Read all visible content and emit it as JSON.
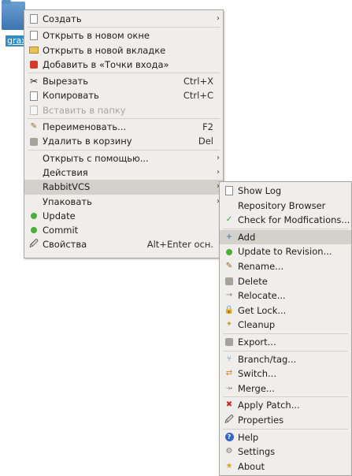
{
  "desktop": {
    "icon_label": "grax"
  },
  "main_menu": {
    "items": [
      {
        "label": "Создать",
        "shortcut": "",
        "submenu": true,
        "icon": "new-icon"
      },
      {
        "sep": true
      },
      {
        "label": "Открыть в новом окне",
        "shortcut": "",
        "icon": "new-window-icon"
      },
      {
        "label": "Открыть в новой вкладке",
        "shortcut": "",
        "icon": "new-tab-icon"
      },
      {
        "label": "Добавить в «Точки входа»",
        "shortcut": "",
        "icon": "bookmark-icon"
      },
      {
        "sep": true
      },
      {
        "label": "Вырезать",
        "shortcut": "Ctrl+X",
        "icon": "cut-icon"
      },
      {
        "label": "Копировать",
        "shortcut": "Ctrl+C",
        "icon": "copy-icon"
      },
      {
        "label": "Вставить в папку",
        "shortcut": "",
        "icon": "paste-icon",
        "disabled": true
      },
      {
        "sep": true
      },
      {
        "label": "Переименовать...",
        "shortcut": "F2",
        "icon": "rename-icon"
      },
      {
        "label": "Удалить в корзину",
        "shortcut": "Del",
        "icon": "trash-icon"
      },
      {
        "sep": true
      },
      {
        "label": "Открыть с помощью...",
        "shortcut": "",
        "submenu": true,
        "icon": ""
      },
      {
        "label": "Действия",
        "shortcut": "",
        "submenu": true,
        "icon": ""
      },
      {
        "label": "RabbitVCS",
        "shortcut": "",
        "submenu": true,
        "icon": "",
        "highlighted": true
      },
      {
        "label": "Упаковать",
        "shortcut": "",
        "submenu": true,
        "icon": ""
      },
      {
        "label": "Update",
        "shortcut": "",
        "icon": "update-icon"
      },
      {
        "label": "Commit",
        "shortcut": "",
        "icon": "commit-icon"
      },
      {
        "label": "Свойства",
        "shortcut": "Alt+Enter осн.",
        "icon": "properties-icon"
      }
    ]
  },
  "sub_menu": {
    "items": [
      {
        "label": "Show Log",
        "icon": "log-icon"
      },
      {
        "label": "Repository Browser",
        "icon": ""
      },
      {
        "label": "Check for Modfications...",
        "icon": "check-icon"
      },
      {
        "sep": true
      },
      {
        "label": "Add",
        "icon": "add-icon",
        "highlighted": true
      },
      {
        "label": "Update to Revision...",
        "icon": "update-revision-icon"
      },
      {
        "label": "Rename...",
        "icon": "rename-icon"
      },
      {
        "label": "Delete",
        "icon": "delete-icon"
      },
      {
        "label": "Relocate...",
        "icon": "relocate-icon"
      },
      {
        "label": "Get Lock...",
        "icon": "lock-icon"
      },
      {
        "label": "Cleanup",
        "icon": "cleanup-icon"
      },
      {
        "sep": true
      },
      {
        "label": "Export...",
        "icon": "export-icon"
      },
      {
        "sep": true
      },
      {
        "label": "Branch/tag...",
        "icon": "branch-icon"
      },
      {
        "label": "Switch...",
        "icon": "switch-icon"
      },
      {
        "label": "Merge...",
        "icon": "merge-icon"
      },
      {
        "sep": true
      },
      {
        "label": "Apply Patch...",
        "icon": "patch-icon"
      },
      {
        "label": "Properties",
        "icon": "properties-icon"
      },
      {
        "sep": true
      },
      {
        "label": "Help",
        "icon": "help-icon"
      },
      {
        "label": "Settings",
        "icon": "settings-icon"
      },
      {
        "label": "About",
        "icon": "about-icon"
      }
    ]
  },
  "colors": {
    "menu_bg": "#efeeed",
    "highlight": "#d4d1cd",
    "selection": "#308cc6"
  }
}
